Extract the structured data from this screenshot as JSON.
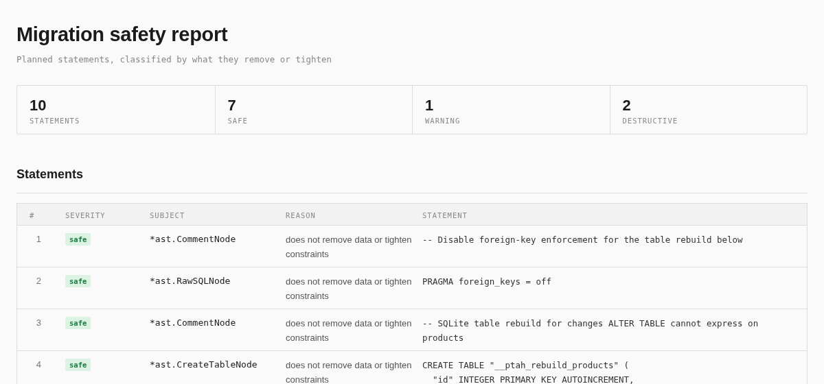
{
  "title": "Migration safety report",
  "subtitle": "Planned statements, classified by what they remove or tighten",
  "stats": [
    {
      "value": "10",
      "label": "STATEMENTS"
    },
    {
      "value": "7",
      "label": "SAFE"
    },
    {
      "value": "1",
      "label": "WARNING"
    },
    {
      "value": "2",
      "label": "DESTRUCTIVE"
    }
  ],
  "section_title": "Statements",
  "table": {
    "columns": [
      "#",
      "SEVERITY",
      "SUBJECT",
      "REASON",
      "STATEMENT"
    ],
    "rows": [
      {
        "number": "1",
        "severity": "safe",
        "kind": "safe",
        "subject": "*ast.CommentNode",
        "reason": "does not remove data or tighten constraints",
        "statement": "-- Disable foreign-key enforcement for the table rebuild below"
      },
      {
        "number": "2",
        "severity": "safe",
        "kind": "safe",
        "subject": "*ast.RawSQLNode",
        "reason": "does not remove data or tighten constraints",
        "statement": "PRAGMA foreign_keys = off"
      },
      {
        "number": "3",
        "severity": "safe",
        "kind": "safe",
        "subject": "*ast.CommentNode",
        "reason": "does not remove data or tighten constraints",
        "statement": "-- SQLite table rebuild for changes ALTER TABLE cannot express on products"
      },
      {
        "number": "4",
        "severity": "safe",
        "kind": "safe",
        "subject": "*ast.CreateTableNode",
        "reason": "does not remove data or tighten constraints",
        "statement": "CREATE TABLE \"__ptah_rebuild_products\" (\n  \"id\" INTEGER PRIMARY KEY AUTOINCREMENT,"
      }
    ]
  }
}
